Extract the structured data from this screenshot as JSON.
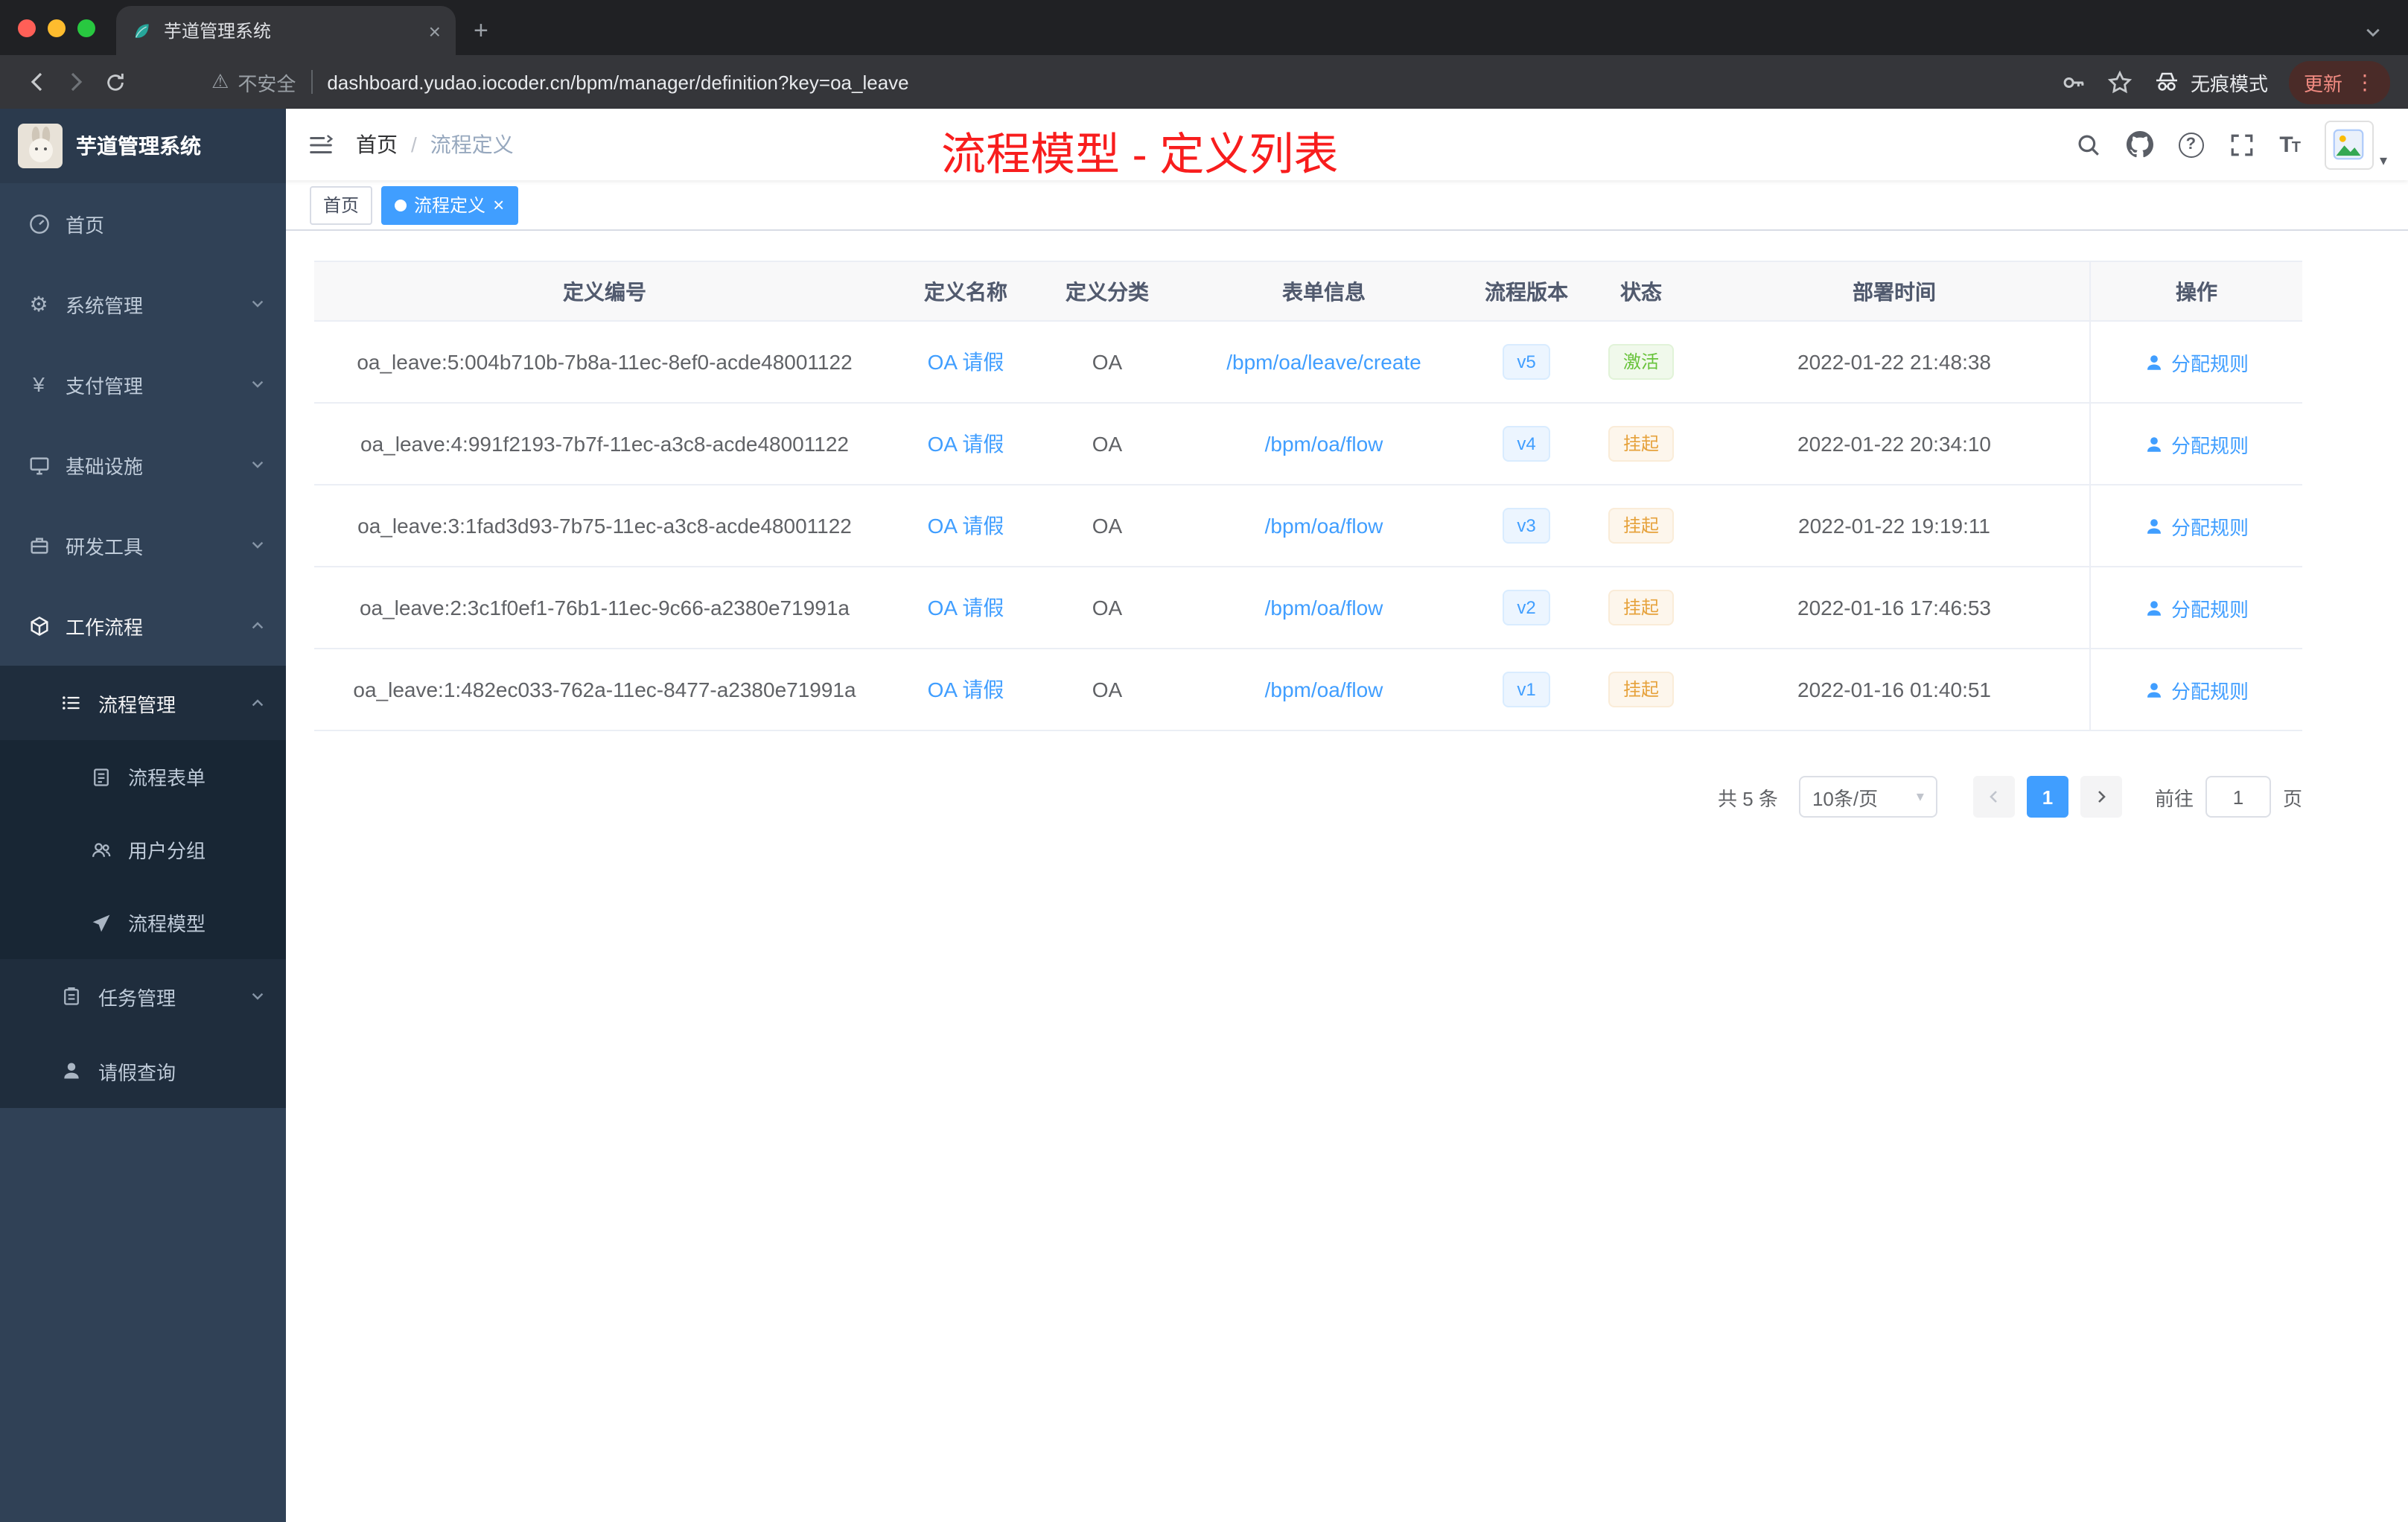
{
  "browser": {
    "tab_title": "芋道管理系统",
    "new_tab": "+",
    "security_label": "不安全",
    "url": "dashboard.yudao.iocoder.cn/bpm/manager/definition?key=oa_leave",
    "incognito_label": "无痕模式",
    "update_label": "更新"
  },
  "sidebar": {
    "logo_title": "芋道管理系统",
    "items": [
      {
        "label": "首页"
      },
      {
        "label": "系统管理"
      },
      {
        "label": "支付管理"
      },
      {
        "label": "基础设施"
      },
      {
        "label": "研发工具"
      },
      {
        "label": "工作流程"
      },
      {
        "label": "流程管理"
      },
      {
        "label": "流程表单"
      },
      {
        "label": "用户分组"
      },
      {
        "label": "流程模型"
      },
      {
        "label": "任务管理"
      },
      {
        "label": "请假查询"
      }
    ]
  },
  "header": {
    "breadcrumb": {
      "home": "首页",
      "separator": "/",
      "current": "流程定义"
    },
    "annotation": "流程模型 - 定义列表"
  },
  "tags": {
    "home": "首页",
    "active": "流程定义"
  },
  "table": {
    "columns": [
      "定义编号",
      "定义名称",
      "定义分类",
      "表单信息",
      "流程版本",
      "状态",
      "部署时间",
      "操作"
    ],
    "action_label": "分配规则",
    "rows": [
      {
        "id": "oa_leave:5:004b710b-7b8a-11ec-8ef0-acde48001122",
        "name": "OA 请假",
        "category": "OA",
        "form": "/bpm/oa/leave/create",
        "version": "v5",
        "status": "激活",
        "status_type": "success",
        "time": "2022-01-22 21:48:38"
      },
      {
        "id": "oa_leave:4:991f2193-7b7f-11ec-a3c8-acde48001122",
        "name": "OA 请假",
        "category": "OA",
        "form": "/bpm/oa/flow",
        "version": "v4",
        "status": "挂起",
        "status_type": "warning",
        "time": "2022-01-22 20:34:10"
      },
      {
        "id": "oa_leave:3:1fad3d93-7b75-11ec-a3c8-acde48001122",
        "name": "OA 请假",
        "category": "OA",
        "form": "/bpm/oa/flow",
        "version": "v3",
        "status": "挂起",
        "status_type": "warning",
        "time": "2022-01-22 19:19:11"
      },
      {
        "id": "oa_leave:2:3c1f0ef1-76b1-11ec-9c66-a2380e71991a",
        "name": "OA 请假",
        "category": "OA",
        "form": "/bpm/oa/flow",
        "version": "v2",
        "status": "挂起",
        "status_type": "warning",
        "time": "2022-01-16 17:46:53"
      },
      {
        "id": "oa_leave:1:482ec033-762a-11ec-8477-a2380e71991a",
        "name": "OA 请假",
        "category": "OA",
        "form": "/bpm/oa/flow",
        "version": "v1",
        "status": "挂起",
        "status_type": "warning",
        "time": "2022-01-16 01:40:51"
      }
    ]
  },
  "pagination": {
    "total": "共 5 条",
    "page_size": "10条/页",
    "page": "1",
    "goto_label": "前往",
    "goto_value": "1",
    "unit_label": "页"
  }
}
